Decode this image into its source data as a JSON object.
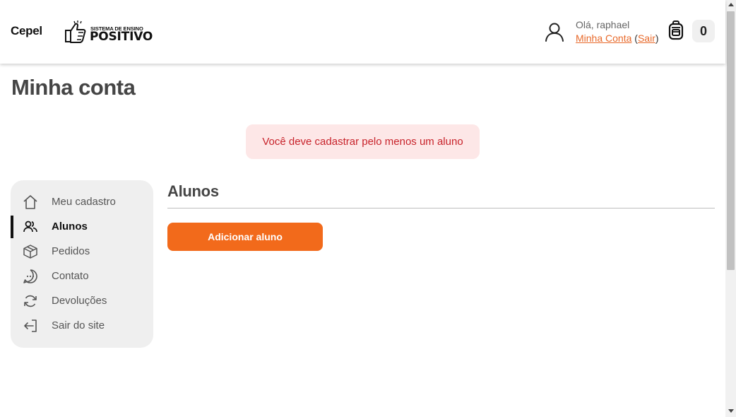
{
  "header": {
    "school_name": "Cepel",
    "logo": {
      "small_text": "SISTEMA DE ENSINO",
      "big_text": "POSITIVO",
      "icon": "thumbs-up-icon"
    },
    "greeting": "Olá, raphael",
    "account_link": "Minha Conta",
    "logout_link": "Sair",
    "cart_icon": "backpack-icon",
    "cart_count": "0"
  },
  "main": {
    "title": "Minha conta",
    "alert": "Você deve cadastrar pelo menos um aluno",
    "section_title": "Alunos",
    "add_button": "Adicionar aluno"
  },
  "sidebar": {
    "items": [
      {
        "label": "Meu cadastro",
        "icon": "home-icon",
        "active": false
      },
      {
        "label": "Alunos",
        "icon": "users-icon",
        "active": true
      },
      {
        "label": "Pedidos",
        "icon": "box-icon",
        "active": false
      },
      {
        "label": "Contato",
        "icon": "chat-icon",
        "active": false
      },
      {
        "label": "Devoluções",
        "icon": "refresh-icon",
        "active": false
      },
      {
        "label": "Sair do site",
        "icon": "logout-icon",
        "active": false
      }
    ]
  },
  "colors": {
    "accent": "#f26a1b",
    "link": "#e8692a",
    "alert_bg": "#fde7e7",
    "alert_text": "#c8232b",
    "sidebar_bg": "#efefef"
  }
}
